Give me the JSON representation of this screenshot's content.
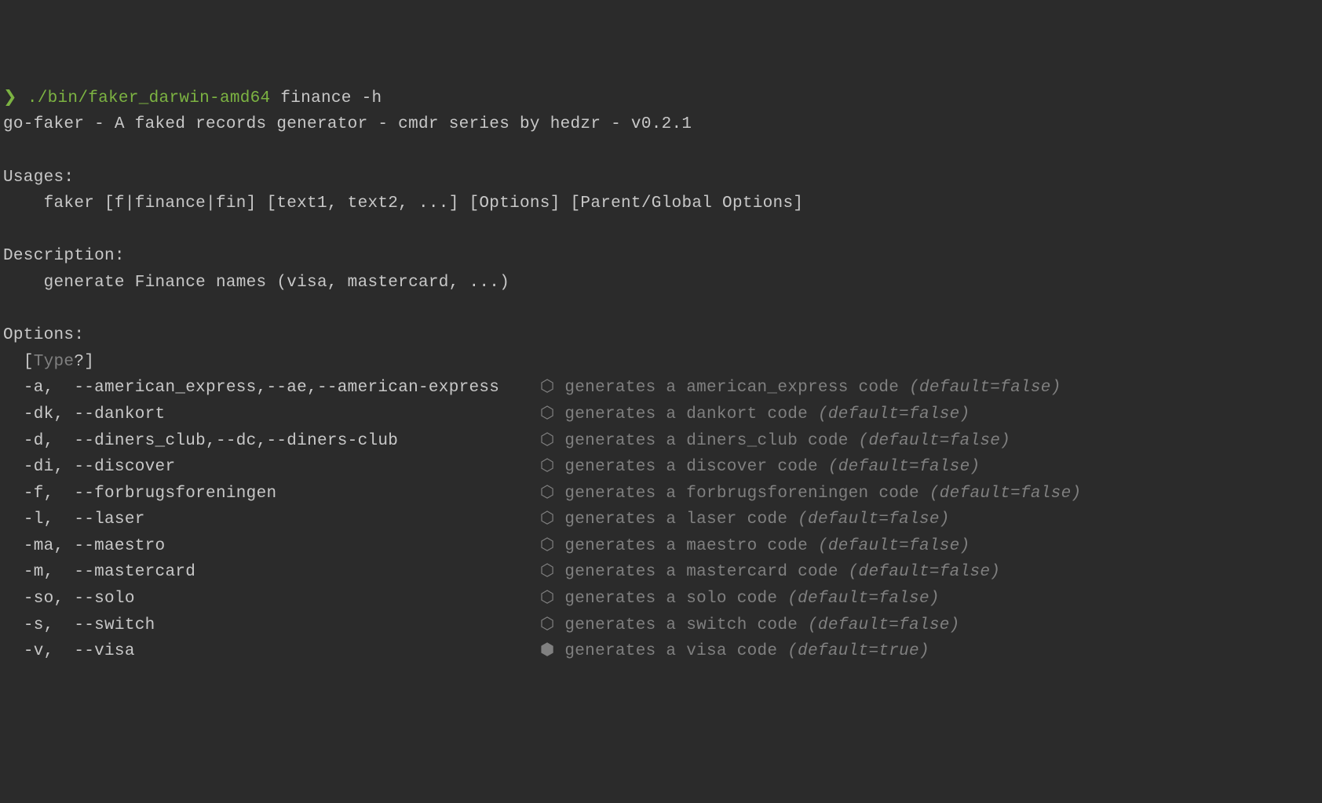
{
  "prompt": {
    "symbol": "❯",
    "command_path": "./bin/faker_darwin-amd64",
    "command_args": "finance -h"
  },
  "header": "go-faker - A faked records generator - cmdr series by hedzr - v0.2.1",
  "usages": {
    "label": "Usages:",
    "text": "faker [f|finance|fin] [text1, text2, ...] [Options] [Parent/Global Options]"
  },
  "description": {
    "label": "Description:",
    "text": "generate Finance names (visa, mastercard, ...)"
  },
  "options": {
    "label": "Options:",
    "type_label": "Type",
    "bullet": "⬡",
    "bullet_filled": "⬢",
    "items": [
      {
        "short": "-a,",
        "long": "--american_express,--ae,--american-express",
        "desc": "generates a american_express code",
        "default": "(default=false)",
        "filled": false
      },
      {
        "short": "-dk,",
        "long": "--dankort",
        "desc": "generates a dankort code",
        "default": "(default=false)",
        "filled": false
      },
      {
        "short": "-d,",
        "long": "--diners_club,--dc,--diners-club",
        "desc": "generates a diners_club code",
        "default": "(default=false)",
        "filled": false
      },
      {
        "short": "-di,",
        "long": "--discover",
        "desc": "generates a discover code",
        "default": "(default=false)",
        "filled": false
      },
      {
        "short": "-f,",
        "long": "--forbrugsforeningen",
        "desc": "generates a forbrugsforeningen code",
        "default": "(default=false)",
        "filled": false
      },
      {
        "short": "-l,",
        "long": "--laser",
        "desc": "generates a laser code",
        "default": "(default=false)",
        "filled": false
      },
      {
        "short": "-ma,",
        "long": "--maestro",
        "desc": "generates a maestro code",
        "default": "(default=false)",
        "filled": false
      },
      {
        "short": "-m,",
        "long": "--mastercard",
        "desc": "generates a mastercard code",
        "default": "(default=false)",
        "filled": false
      },
      {
        "short": "-so,",
        "long": "--solo",
        "desc": "generates a solo code",
        "default": "(default=false)",
        "filled": false
      },
      {
        "short": "-s,",
        "long": "--switch",
        "desc": "generates a switch code",
        "default": "(default=false)",
        "filled": false
      },
      {
        "short": "-v,",
        "long": "--visa",
        "desc": "generates a visa code",
        "default": "(default=true)",
        "filled": true
      }
    ]
  }
}
